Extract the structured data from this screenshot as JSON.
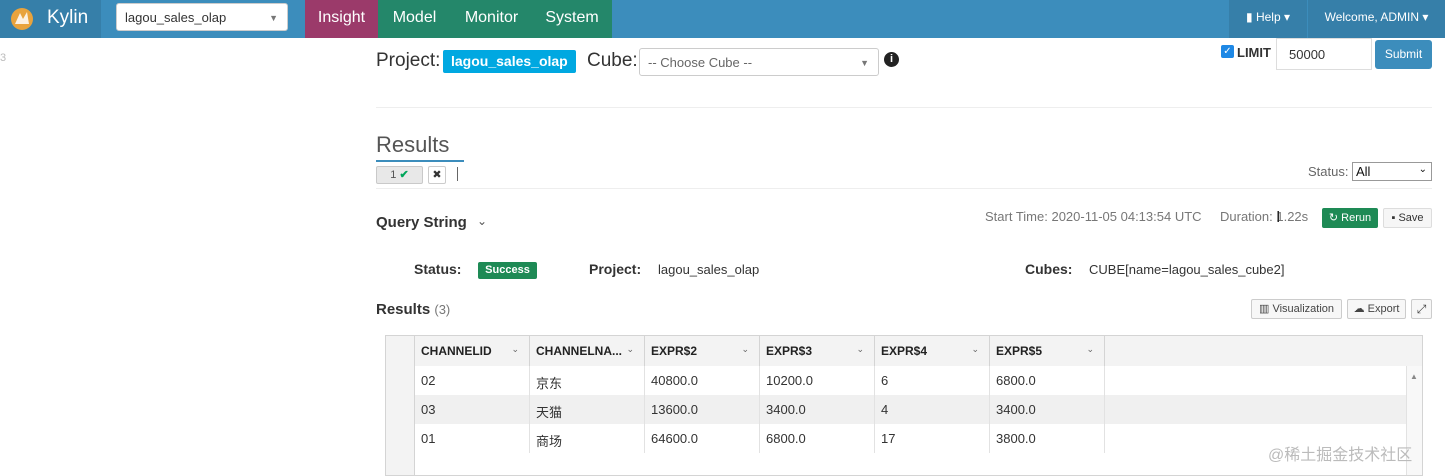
{
  "nav": {
    "brand": "Kylin",
    "project_select": "lagou_sales_olap",
    "tabs": [
      "Insight",
      "Model",
      "Monitor",
      "System"
    ],
    "help": "Help",
    "welcome": "Welcome, ADMIN"
  },
  "side_number": "3",
  "query_bar": {
    "project_label": "Project:",
    "project_value": "lagou_sales_olap",
    "cube_label": "Cube:",
    "cube_placeholder": "-- Choose Cube --",
    "limit_label": "LIMIT",
    "limit_checked": true,
    "limit_value": "50000",
    "submit_label": "Submit"
  },
  "results_tabs": {
    "title": "Results",
    "tab_label": "1",
    "status_label": "Status:",
    "status_value": "All"
  },
  "query": {
    "query_string_label": "Query String",
    "start_time": "Start Time: 2020-11-05 04:13:54 UTC",
    "duration": "Duration: 1.22s",
    "rerun_label": "Rerun",
    "save_label": "Save",
    "status_label": "Status:",
    "status_value": "Success",
    "project_label": "Project:",
    "project_value": "lagou_sales_olap",
    "cubes_label": "Cubes:",
    "cubes_value": "CUBE[name=lagou_sales_cube2]"
  },
  "results": {
    "label": "Results",
    "count": "(3)",
    "visualization_label": "Visualization",
    "export_label": "Export",
    "columns": [
      "CHANNELID",
      "CHANNELNA...",
      "EXPR$2",
      "EXPR$3",
      "EXPR$4",
      "EXPR$5"
    ],
    "rows": [
      [
        "02",
        "京东",
        "40800.0",
        "10200.0",
        "6",
        "6800.0"
      ],
      [
        "03",
        "天猫",
        "13600.0",
        "3400.0",
        "4",
        "3400.0"
      ],
      [
        "01",
        "商场",
        "64600.0",
        "6800.0",
        "17",
        "3800.0"
      ]
    ]
  },
  "watermark": "@稀土掘金技术社区",
  "colors": {
    "navbar": "#3c8dbc",
    "insight_tab": "#9b3a6a",
    "nav_tab": "#24876a",
    "success": "#1e8a55",
    "project_badge": "#00a8e1"
  }
}
